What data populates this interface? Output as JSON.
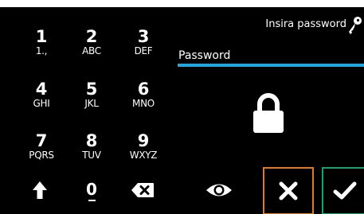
{
  "prompt": "Insira password",
  "field": {
    "label": "Password"
  },
  "keypad": [
    {
      "digit": "1",
      "letters": "1.,"
    },
    {
      "digit": "2",
      "letters": "ABC"
    },
    {
      "digit": "3",
      "letters": "DEF"
    },
    {
      "digit": "4",
      "letters": "GHI"
    },
    {
      "digit": "5",
      "letters": "JKL"
    },
    {
      "digit": "6",
      "letters": "MNO"
    },
    {
      "digit": "7",
      "letters": "PQRS"
    },
    {
      "digit": "8",
      "letters": "TUV"
    },
    {
      "digit": "9",
      "letters": "WXYZ"
    },
    {
      "digit": "0"
    }
  ],
  "icons": {
    "shift": "shift-arrow-up-icon",
    "backspace": "backspace-icon",
    "eye": "eye-icon",
    "lock": "lock-icon",
    "key": "key-icon",
    "cancel": "x-icon",
    "ok": "checkmark-icon"
  },
  "colors": {
    "background": "#000000",
    "field_underline": "#1ea7e0",
    "cancel_border": "#e07a1f",
    "ok_border": "#16a36b",
    "foreground": "#ffffff"
  }
}
